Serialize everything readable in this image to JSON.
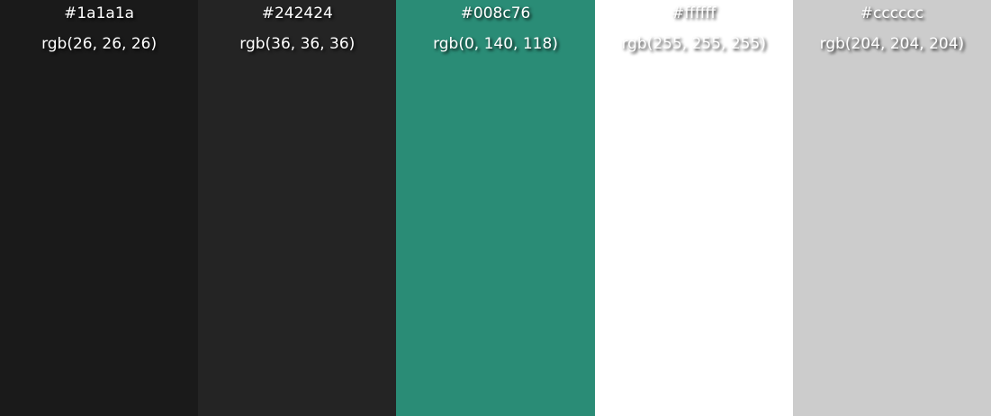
{
  "swatches": [
    {
      "hex": "#1a1a1a",
      "rgb": "rgb(26, 26, 26)",
      "color": "#1a1a1a"
    },
    {
      "hex": "#242424",
      "rgb": "rgb(36, 36, 36)",
      "color": "#242424"
    },
    {
      "hex": "#008c76",
      "rgb": "rgb(0, 140, 118)",
      "color": "#2a8c76"
    },
    {
      "hex": "#ffffff",
      "rgb": "rgb(255, 255, 255)",
      "color": "#ffffff"
    },
    {
      "hex": "#cccccc",
      "rgb": "rgb(204, 204, 204)",
      "color": "#cccccc"
    }
  ]
}
